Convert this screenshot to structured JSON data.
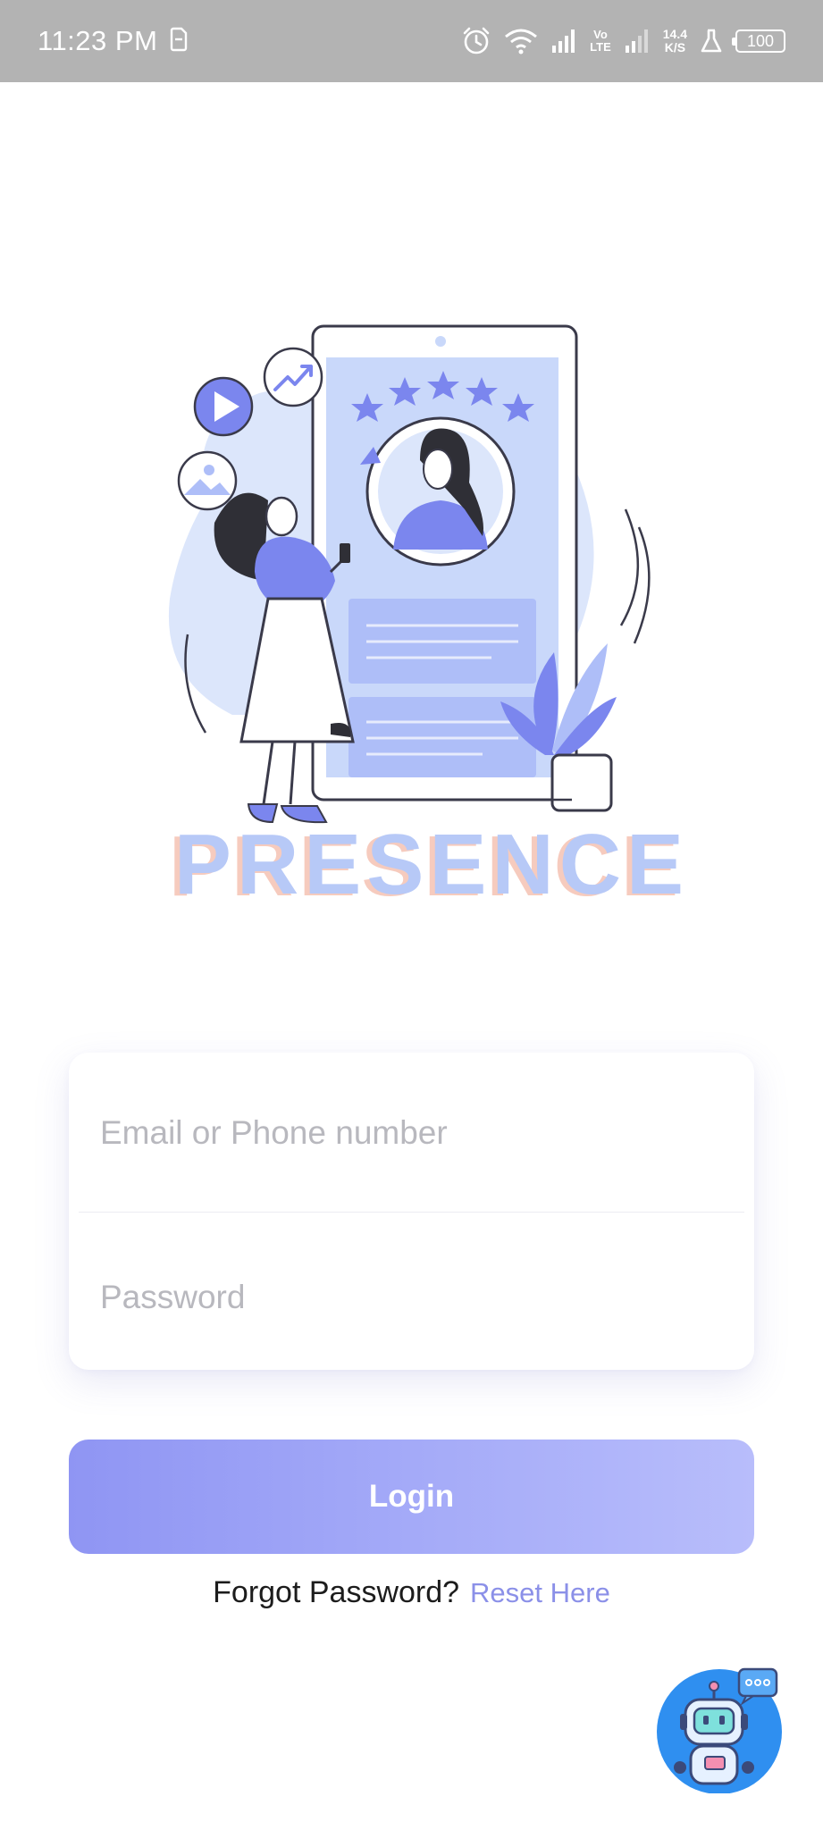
{
  "status_bar": {
    "time": "11:23 PM",
    "volte_top": "Vo",
    "volte_bottom": "LTE",
    "speed_value": "14.4",
    "speed_unit": "K/S",
    "battery": "100",
    "icons": [
      "sim-icon",
      "alarm-icon",
      "wifi-icon",
      "signal-icon",
      "flask-icon",
      "battery-icon"
    ]
  },
  "hero": {
    "brand_text": "PRESENCE",
    "colors": {
      "accent": "#7b86ee",
      "light_blue": "#dbe5fb",
      "brand_blue": "#b7c9f7",
      "brand_peach": "#f6cbbe"
    }
  },
  "form": {
    "email_placeholder": "Email or Phone number",
    "password_placeholder": "Password",
    "login_label": "Login"
  },
  "footer": {
    "forgot_text": "Forgot Password?",
    "reset_link": "Reset Here"
  },
  "chatbot": {
    "icon": "robot-icon"
  },
  "colors": {
    "status_bar_bg": "#b3b3b3",
    "button_gradient_start": "#8f95f3",
    "button_gradient_end": "#b8bdfb",
    "link": "#8b90e8"
  }
}
